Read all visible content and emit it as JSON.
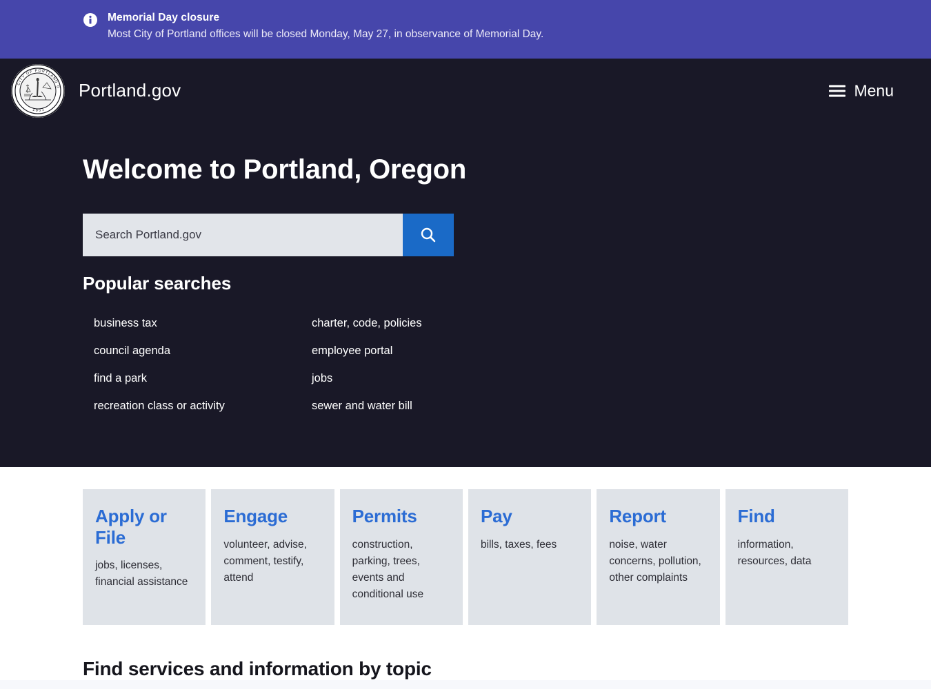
{
  "alert": {
    "icon": "info-circle-icon",
    "title": "Memorial Day closure",
    "message": "Most City of Portland offices will be closed Monday, May 27, in observance of Memorial Day.",
    "background_color": "#4646ab"
  },
  "header": {
    "logo": {
      "icon": "city-of-portland-seal-icon",
      "ring_text": "CITY OF PORTLAND OREGON",
      "year": "1851"
    },
    "site_name": "Portland.gov",
    "menu": {
      "icon": "hamburger-menu-icon",
      "label": "Menu"
    },
    "background_color": "#191827"
  },
  "hero": {
    "title": "Welcome to Portland, Oregon",
    "search": {
      "placeholder": "Search Portland.gov",
      "value": "",
      "submit_icon": "search-icon",
      "submit_color": "#1a6ac7"
    },
    "popular": {
      "title": "Popular searches",
      "links": [
        {
          "label": "business tax"
        },
        {
          "label": "charter, code, policies"
        },
        {
          "label": "council agenda"
        },
        {
          "label": "employee portal"
        },
        {
          "label": "find a park"
        },
        {
          "label": "jobs"
        },
        {
          "label": "recreation class or activity"
        },
        {
          "label": "sewer and water bill"
        }
      ]
    }
  },
  "cards": {
    "accent_color": "#2b6cd4",
    "background_color": "#dfe3e8",
    "items": [
      {
        "title": "Apply or File",
        "desc": "jobs, licenses, financial assistance"
      },
      {
        "title": "Engage",
        "desc": "volunteer, advise, comment, testify, attend"
      },
      {
        "title": "Permits",
        "desc": "construction, parking, trees, events and conditional use"
      },
      {
        "title": "Pay",
        "desc": "bills, taxes, fees"
      },
      {
        "title": "Report",
        "desc": "noise, water concerns, pollution, other complaints"
      },
      {
        "title": "Find",
        "desc": "information, resources, data"
      }
    ]
  },
  "topics": {
    "title": "Find services and information by topic"
  }
}
